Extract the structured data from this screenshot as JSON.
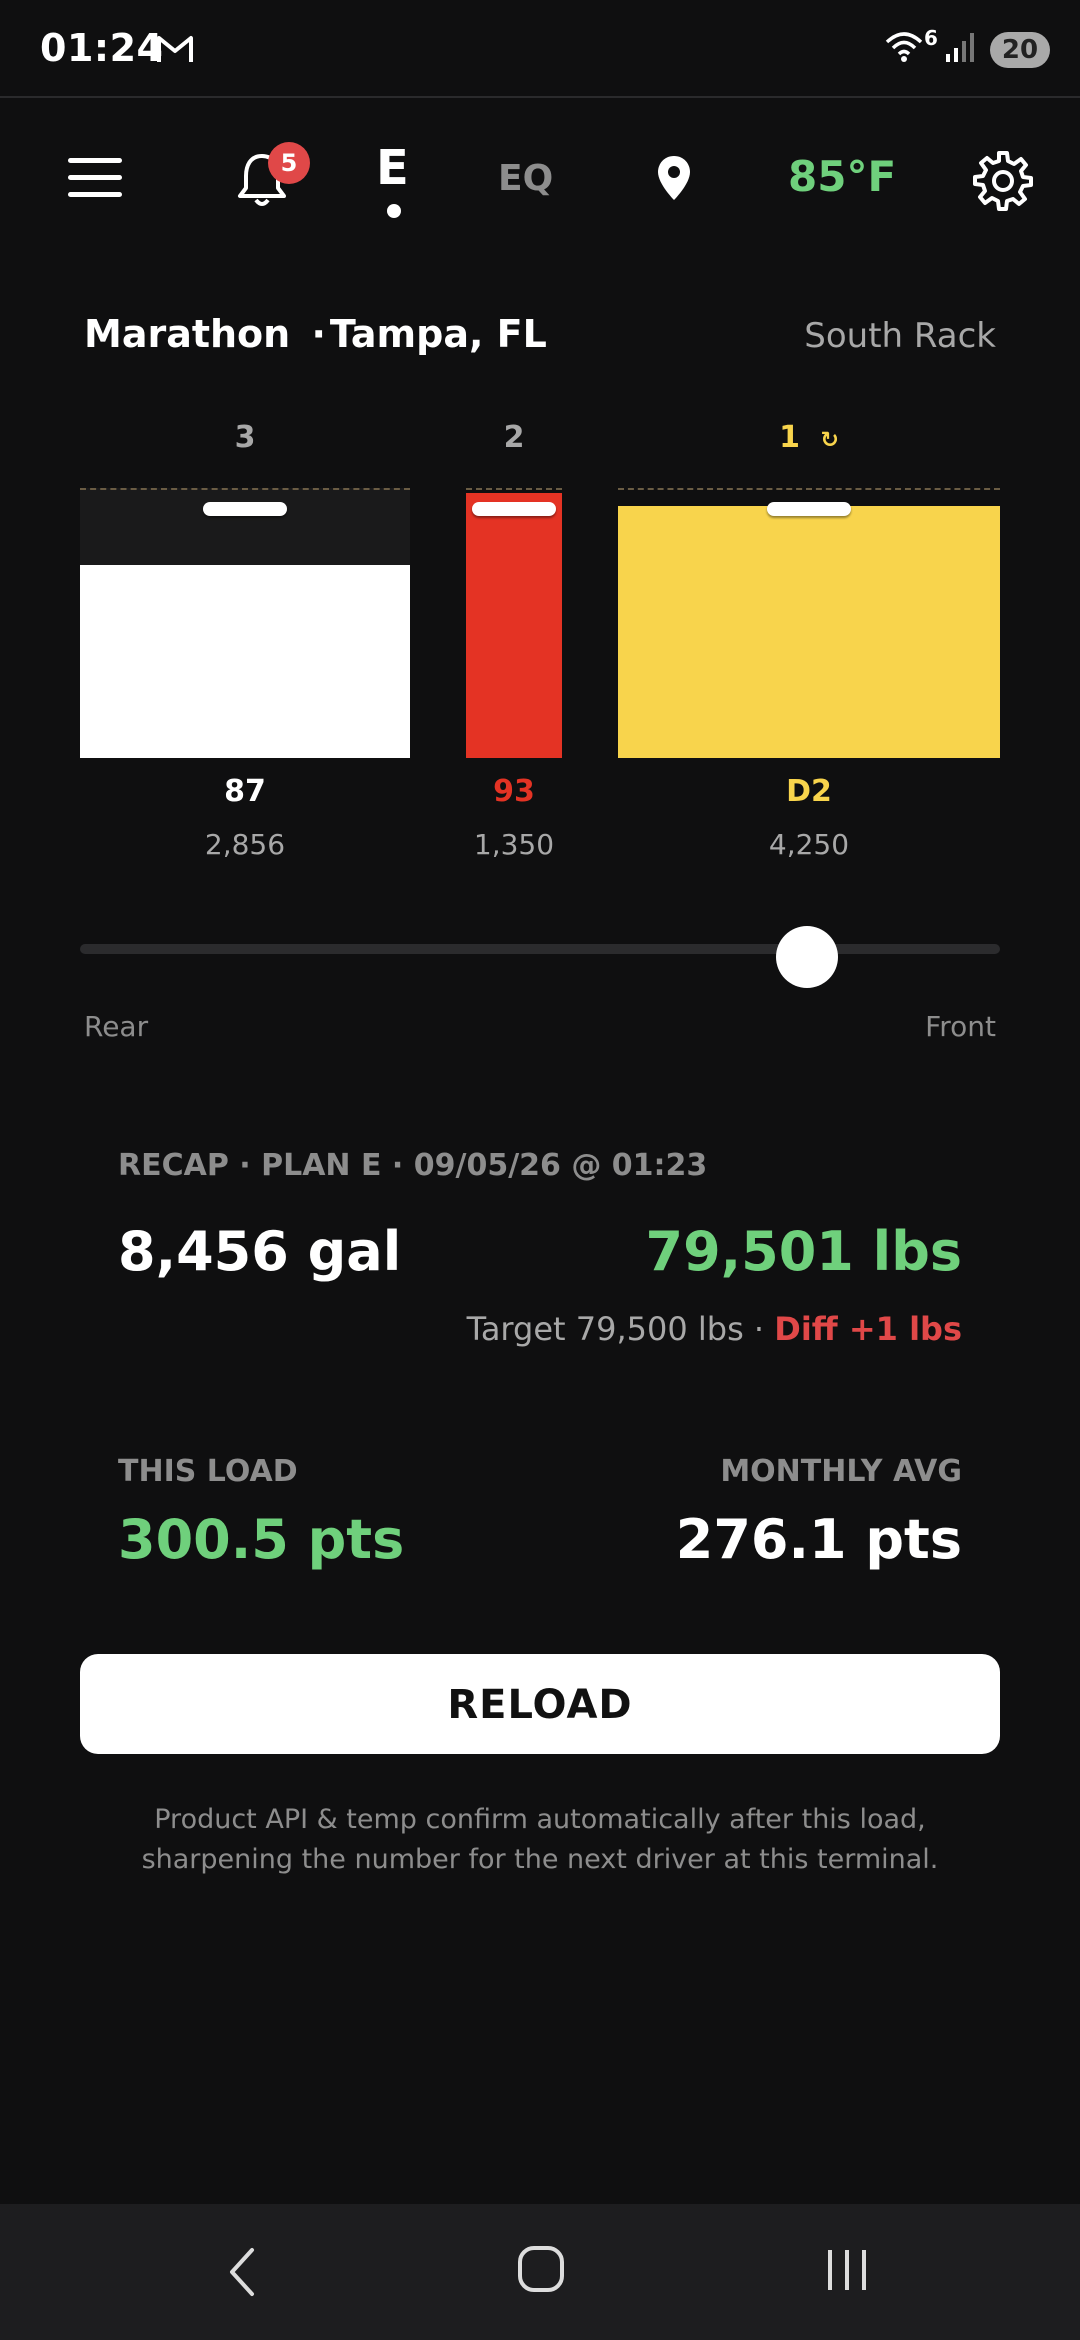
{
  "status_bar": {
    "time": "01:24",
    "wifi_label": "6",
    "battery": "20",
    "icons": [
      "gmail-icon",
      "wifi-icon",
      "signal-icon",
      "battery-icon"
    ]
  },
  "top_bar": {
    "notification_count": "5",
    "brand": "E",
    "eq_label": "EQ",
    "temperature": "85°F",
    "icons": [
      "menu-icon",
      "bell-icon",
      "location-pin-icon",
      "gear-icon"
    ]
  },
  "terminal": {
    "supplier": "Marathon",
    "separator": "·",
    "location": "Tampa, FL",
    "rack": "South Rack"
  },
  "compartments": [
    {
      "number": "3",
      "product": "87",
      "gallons": "2,856",
      "fill_fraction": 0.72,
      "color": "#ffffff",
      "product_color": "#ffffff"
    },
    {
      "number": "2",
      "product": "93",
      "gallons": "1,350",
      "fill_fraction": 0.99,
      "color": "#e43324",
      "product_color": "#e43324"
    },
    {
      "number": "1",
      "number_suffix": "↻",
      "product": "D2",
      "gallons": "4,250",
      "fill_fraction": 0.94,
      "color": "#f8d44c",
      "product_color": "#f8d44c"
    }
  ],
  "slider": {
    "rear_label": "Rear",
    "front_label": "Front",
    "value": 0.79
  },
  "recap": {
    "header": "RECAP · PLAN E · 09/05/26 @ 01:23",
    "total_gallons": "8,456 gal",
    "total_weight": "79,501 lbs",
    "target": "Target 79,500 lbs ·",
    "diff": "Diff +1 lbs"
  },
  "points": {
    "this_load_label": "THIS LOAD",
    "this_load_value": "300.5 pts",
    "monthly_label": "MONTHLY AVG",
    "monthly_value": "276.1 pts"
  },
  "reload_button": "RELOAD",
  "footnote": "Product API & temp confirm automatically after this load, sharpening the number for the next driver at this terminal.",
  "colors": {
    "accent_green": "#6fd07c",
    "alert_red": "#e04848",
    "background": "#0f0f10"
  }
}
